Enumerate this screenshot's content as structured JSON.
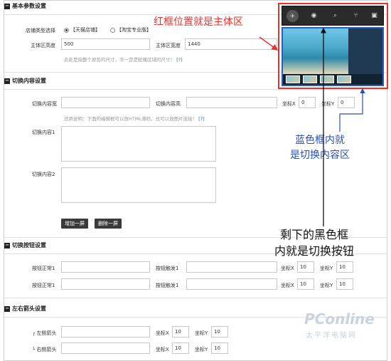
{
  "basic": {
    "title": "基本参数设置",
    "store_type_label": "店铺类型选择",
    "store_type_options": [
      "【天猫店铺】",
      "【淘宝专业版】"
    ],
    "height_label": "主体区高度",
    "height_value": "500",
    "width_label": "主体区宽度",
    "width_value": "1440",
    "hint": "此处是指整个屏剪的尺寸，不一定是轮播区域的尺寸！",
    "hint_link": "[?]"
  },
  "switch_content": {
    "title": "切换内容设置",
    "width_label": "切换内容宽",
    "height_label": "切换内容高",
    "x_label": "坐标X",
    "x_value": "0",
    "y_label": "坐标Y",
    "y_value": "0",
    "hint": "适用说明：下面的编辑框可以放HTML源码，也可以放图片连接！",
    "hint_link": "[?]",
    "content1_label": "切换内容1",
    "content2_label": "切换内容2",
    "add_button": "增加一屏",
    "delete_button": "删除一屏"
  },
  "switch_buttons": {
    "title": "切换按钮设置",
    "rows": [
      {
        "normal_label": "按钮正常1",
        "trigger_label": "按钮触发1",
        "x_label": "坐标X",
        "x_value": "10",
        "y_label": "坐标Y",
        "y_value": "10"
      },
      {
        "normal_label": "按钮正常1",
        "trigger_label": "按钮触发1",
        "x_label": "坐标X",
        "x_value": "10",
        "y_label": "坐标Y",
        "y_value": "10"
      }
    ]
  },
  "arrows": {
    "title": "左右箭头设置",
    "left_label": "左侧箭头",
    "right_label": "右侧箭头",
    "left_x_label": "坐标X",
    "left_x_value": "10",
    "left_y_label": "坐标Y",
    "left_y_value": "10",
    "right_x_label": "坐标X",
    "right_x_value": "10",
    "right_y_label": "坐标Y",
    "right_y_value": "10"
  },
  "annotations": {
    "red": "红框位置就是主体区",
    "blue_line1": "蓝色框内就",
    "blue_line2": "是切换内容区",
    "black_line1": "剩下的黑色框",
    "black_line2": "内就是切换按钮"
  },
  "watermark": {
    "brand": "PConline",
    "sub": "太平洋电脑网"
  },
  "colors": {
    "red": "#e8322c",
    "blue": "#2e5bbf",
    "black": "#111111"
  }
}
